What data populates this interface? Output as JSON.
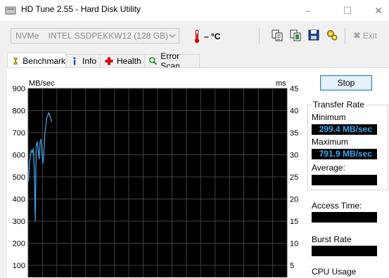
{
  "window": {
    "title": "HD Tune 2.55 - Hard Disk Utility",
    "minimize": "–",
    "maximize": "☐",
    "close": "✕"
  },
  "toolbar": {
    "drive_select": "NVMe    INTEL SSDPEKKW12 (128 GB)",
    "temperature": "– °C",
    "exit_label": "Exit"
  },
  "tabs": [
    {
      "label": "Benchmark",
      "icon": "benchmark-icon"
    },
    {
      "label": "Info",
      "icon": "info-icon"
    },
    {
      "label": "Health",
      "icon": "health-cross-icon"
    },
    {
      "label": "Error Scan",
      "icon": "magnifier-icon"
    }
  ],
  "controls": {
    "stop_label": "Stop"
  },
  "transfer_rate": {
    "title": "Transfer Rate",
    "minimum_label": "Minimum",
    "minimum_value": "299.4 MB/sec",
    "maximum_label": "Maximum",
    "maximum_value": "791.9 MB/sec",
    "average_label": "Average:"
  },
  "access_time_label": "Access Time:",
  "burst_rate_label": "Burst Rate",
  "cpu_usage_label": "CPU Usage",
  "colors": {
    "plot_bg": "#000000",
    "grid": "#404040",
    "series": "#40a0e0",
    "value_text": "#3aaaf0"
  },
  "chart_data": {
    "type": "line",
    "xlabel": "",
    "ylabel": "MB/sec",
    "y2label": "ms",
    "ylim": [
      0,
      900
    ],
    "y2lim": [
      0,
      45
    ],
    "y_ticks": [
      "900",
      "800",
      "700",
      "600",
      "500",
      "400",
      "300",
      "200",
      "100"
    ],
    "y2_ticks": [
      "45",
      "40",
      "35",
      "30",
      "25",
      "20",
      "15",
      "10",
      "5"
    ],
    "grid": true,
    "series": [
      {
        "x": [
          0,
          0.5,
          1,
          1.5,
          2,
          2.5,
          3,
          3.5,
          4,
          4.5,
          5,
          5.5,
          6,
          6.5,
          7,
          7.5,
          8,
          8.5,
          9,
          9.5,
          10,
          10.5,
          11,
          11.5,
          12
        ],
        "y": [
          480,
          560,
          600,
          620,
          610,
          630,
          520,
          300,
          640,
          660,
          620,
          580,
          660,
          670,
          600,
          560,
          620,
          700,
          740,
          770,
          780,
          790,
          775,
          765,
          750
        ]
      }
    ]
  }
}
